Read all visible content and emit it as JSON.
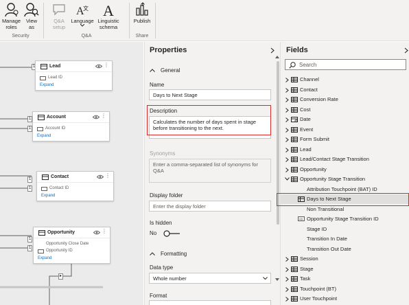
{
  "ribbon": {
    "groups": [
      {
        "label": "Security"
      },
      {
        "label": "Q&A"
      },
      {
        "label": "Share"
      }
    ],
    "buttons": {
      "manage_roles": "Manage roles",
      "view_as": "View as",
      "qa_setup": "Q&A setup",
      "language": "Language",
      "linguistic_schema": "Linguistic schema",
      "publish": "Publish"
    }
  },
  "canvas": {
    "cards": [
      {
        "title": "Lead",
        "field": "Lead ID",
        "expand": "Expand"
      },
      {
        "title": "Account",
        "field": "Account ID",
        "expand": "Expand"
      },
      {
        "title": "Contact",
        "field": "Contact ID",
        "expand": "Expand"
      },
      {
        "title": "Opportunity",
        "fields": [
          "Opportunity Close Date",
          "Opportunity ID"
        ],
        "expand": "Expand"
      }
    ],
    "rel_label": "1"
  },
  "properties": {
    "title": "Properties",
    "general_section": "General",
    "name_label": "Name",
    "name_value": "Days to Next Stage",
    "description_label": "Description",
    "description_value": "Calculates the number of days spent in stage before transitioning to the next.",
    "synonyms_label": "Synonyms",
    "synonyms_placeholder": "Enter a comma-separated list of synonyms for Q&A",
    "display_folder_label": "Display folder",
    "display_folder_placeholder": "Enter the display folder",
    "is_hidden_label": "Is hidden",
    "is_hidden_value": "No",
    "formatting_section": "Formatting",
    "data_type_label": "Data type",
    "data_type_value": "Whole number",
    "format_label": "Format"
  },
  "fields": {
    "title": "Fields",
    "search_placeholder": "Search",
    "items": [
      {
        "label": "Channel"
      },
      {
        "label": "Contact"
      },
      {
        "label": "Conversion Rate"
      },
      {
        "label": "Cost"
      },
      {
        "label": "Date"
      },
      {
        "label": "Event"
      },
      {
        "label": "Form Submit"
      },
      {
        "label": "Lead"
      },
      {
        "label": "Lead/Contact Stage Transition"
      },
      {
        "label": "Opportunity"
      },
      {
        "label": "Opportunity Stage Transition"
      },
      {
        "label": "Attribution Touchpoint (BAT) ID"
      },
      {
        "label": "Days to Next Stage"
      },
      {
        "label": "Non Transitional"
      },
      {
        "label": "Opportunity Stage Transition ID"
      },
      {
        "label": "Stage ID"
      },
      {
        "label": "Transition In Date"
      },
      {
        "label": "Transition Out Date"
      },
      {
        "label": "Session"
      },
      {
        "label": "Stage"
      },
      {
        "label": "Task"
      },
      {
        "label": "Touchpoint (BT)"
      },
      {
        "label": "User Touchpoint"
      }
    ]
  },
  "colors": {
    "highlight": "#d62b2b",
    "accent": "#0f6cbd"
  }
}
